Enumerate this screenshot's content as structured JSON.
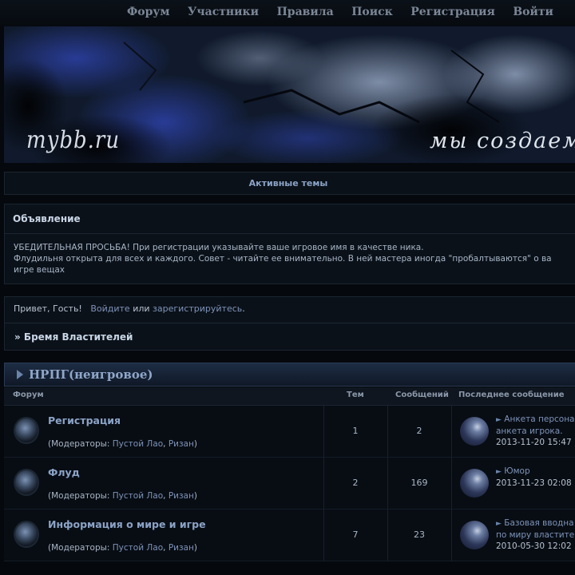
{
  "nav": {
    "items": [
      "Форум",
      "Участники",
      "Правила",
      "Поиск",
      "Регистрация",
      "Войти"
    ]
  },
  "banner": {
    "logo": "mybb.ru",
    "slogan": "мы создаем общ"
  },
  "active_topics": "Активные темы",
  "announcement": {
    "title": "Объявление",
    "lines": [
      "УБЕДИТЕЛЬНАЯ ПРОСЬБА! При регистрации указывайте ваше игровое имя в качестве ника.",
      "Флудильня открыта для всех и каждого. Совет - читайте ее внимательно. В ней мастера иногда \"пробалтываются\" о ва",
      "игре вещах"
    ]
  },
  "welcome": {
    "greeting": "Привет, Гость!",
    "login": "Войдите",
    "or": "или",
    "register": "зарегистрируйтесь",
    "dot": ".",
    "breadcrumb": "» Бремя Властителей"
  },
  "category": {
    "title": "НРПГ(неигровое)",
    "columns": {
      "forum": "Форум",
      "topics": "Тем",
      "posts": "Сообщений",
      "last": "Последнее сообщение"
    }
  },
  "forums": [
    {
      "name": "Регистрация",
      "mods_prefix": "(Модераторы: ",
      "mod1": "Пустой Лао",
      "comma": ", ",
      "mod2": "Ризан",
      "mods_suffix": ")",
      "topics": "1",
      "posts": "2",
      "last_title_1": "Анкета персона",
      "last_title_2": "анкета игрока.",
      "last_date": "2013-11-20 15:47"
    },
    {
      "name": "Флуд",
      "mods_prefix": "(Модераторы: ",
      "mod1": "Пустой Лао",
      "comma": ", ",
      "mod2": "Ризан",
      "mods_suffix": ")",
      "topics": "2",
      "posts": "169",
      "last_title_1": "Юмор",
      "last_title_2": "",
      "last_date": "2013-11-23 02:08"
    },
    {
      "name": "Информация о мире и игре",
      "mods_prefix": "(Модераторы: ",
      "mod1": "Пустой Лао",
      "comma": ", ",
      "mod2": "Ризан",
      "mods_suffix": ")",
      "topics": "7",
      "posts": "23",
      "last_title_1": "Базовая вводна",
      "last_title_2": "по миру властите",
      "last_date": "2010-05-30 12:02"
    }
  ]
}
